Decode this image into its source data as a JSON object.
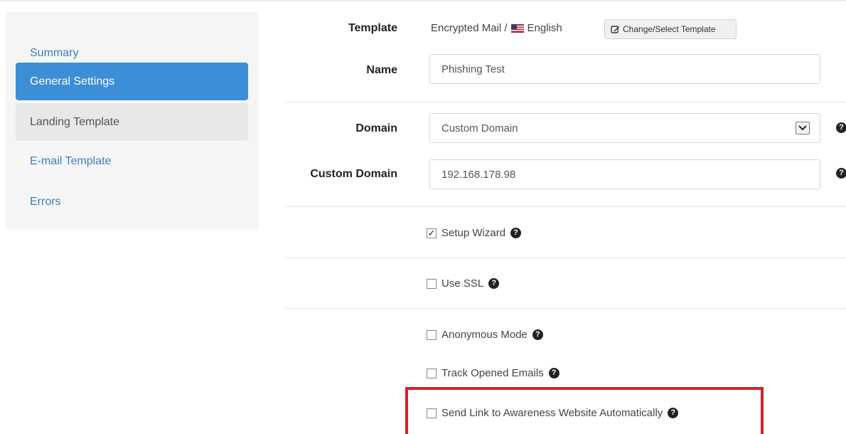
{
  "sidebar": {
    "items": [
      {
        "label": "Summary",
        "state": "normal"
      },
      {
        "label": "General Settings",
        "state": "active"
      },
      {
        "label": "Landing Template",
        "state": "hover"
      },
      {
        "label": "E-mail Template",
        "state": "normal"
      },
      {
        "label": "Errors",
        "state": "normal"
      }
    ]
  },
  "form": {
    "template": {
      "label": "Template",
      "value_prefix": "Encrypted Mail /",
      "language": "English",
      "change_button": "Change/Select Template"
    },
    "name": {
      "label": "Name",
      "value": "Phishing Test"
    },
    "domain": {
      "label": "Domain",
      "selected": "Custom Domain"
    },
    "custom_domain": {
      "label": "Custom Domain",
      "value": "192.168.178.98"
    },
    "options": {
      "setup_wizard": {
        "label": "Setup Wizard",
        "checked": true
      },
      "use_ssl": {
        "label": "Use SSL",
        "checked": false
      },
      "anonymous_mode": {
        "label": "Anonymous Mode",
        "checked": false
      },
      "track_opened": {
        "label": "Track Opened Emails",
        "checked": false
      },
      "send_link": {
        "label": "Send Link to Awareness Website Automatically",
        "checked": false
      }
    }
  },
  "colors": {
    "active_nav": "#3c8ed6",
    "link": "#3a7fc0",
    "highlight": "#d6202c"
  }
}
